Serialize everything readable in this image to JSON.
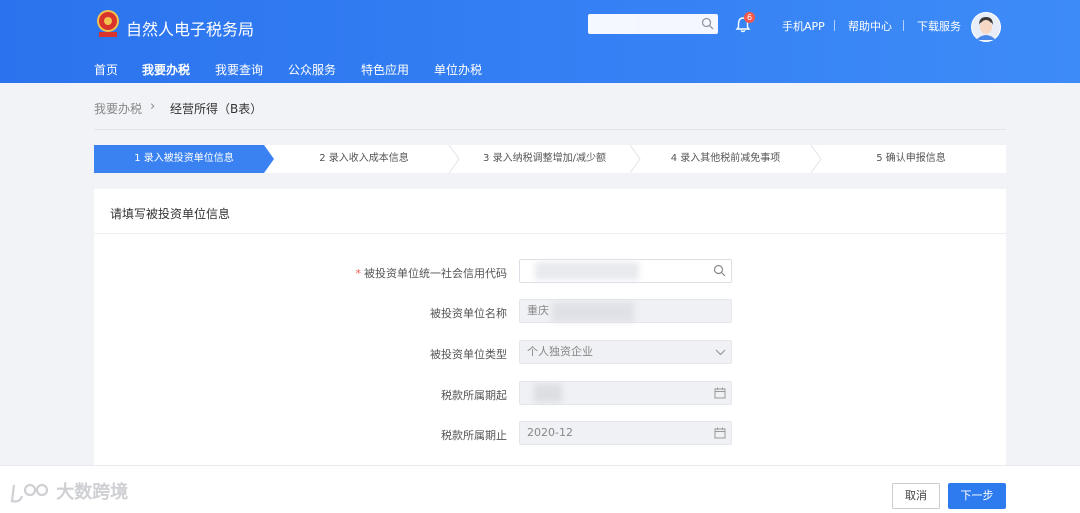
{
  "header": {
    "site_title": "自然人电子税务局",
    "notification_count": "6",
    "links": [
      "手机APP",
      "帮助中心",
      "下载服务"
    ]
  },
  "nav": {
    "items": [
      "首页",
      "我要办税",
      "我要查询",
      "公众服务",
      "特色应用",
      "单位办税"
    ],
    "active": "我要办税"
  },
  "breadcrumb": {
    "parent": "我要办税",
    "current": "经营所得（B表）"
  },
  "steps": [
    "1 录入被投资单位信息",
    "2 录入收入成本信息",
    "3 录入纳税调整增加/减少额",
    "4 录入其他税前减免事项",
    "5 确认申报信息"
  ],
  "form": {
    "title": "请填写被投资单位信息",
    "credit_code_label": "被投资单位统一社会信用代码",
    "required_mark": "*",
    "name_label": "被投资单位名称",
    "name_value": "重庆",
    "type_label": "被投资单位类型",
    "type_value": "个人独资企业",
    "period_start_label": "税款所属期起",
    "period_end_label": "税款所属期止",
    "period_end_value": "2020-12"
  },
  "footer": {
    "watermark": "大数跨境",
    "cancel_label": "取消",
    "next_label": "下一步"
  },
  "colors": {
    "primary": "#2e7bf0",
    "header": "#2b73ee",
    "required": "#f5584c"
  }
}
